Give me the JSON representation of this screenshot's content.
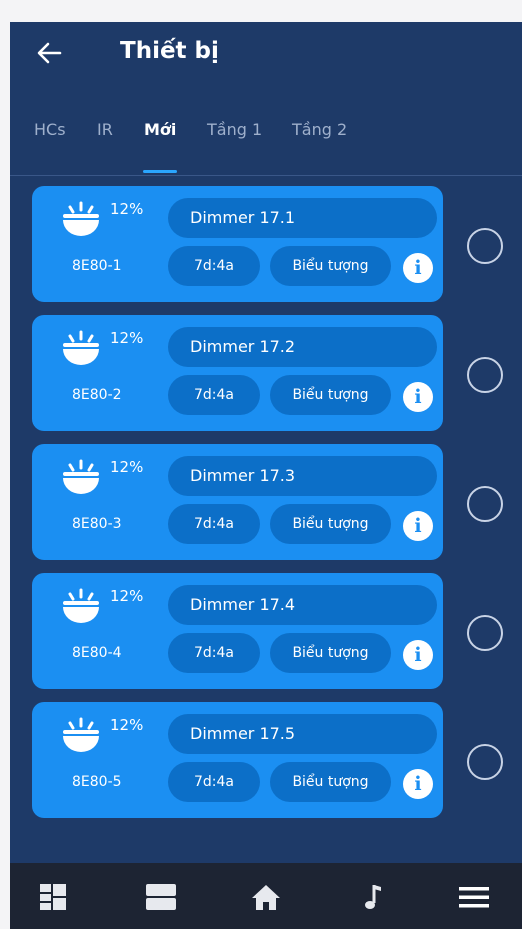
{
  "header": {
    "back_icon": "arrow-left-icon",
    "title": "Thiết bị"
  },
  "tabs": [
    {
      "label": "HCs",
      "active": false
    },
    {
      "label": "IR",
      "active": false
    },
    {
      "label": "Mới",
      "active": true
    },
    {
      "label": "Tầng 1",
      "active": false
    },
    {
      "label": "Tầng 2",
      "active": false
    }
  ],
  "devices": [
    {
      "level": "12%",
      "code": "8E80-1",
      "name": "Dimmer 17.1",
      "address": "7d:4a",
      "icon_label": "Biểu tượng",
      "selected": false
    },
    {
      "level": "12%",
      "code": "8E80-2",
      "name": "Dimmer 17.2",
      "address": "7d:4a",
      "icon_label": "Biểu tượng",
      "selected": false
    },
    {
      "level": "12%",
      "code": "8E80-3",
      "name": "Dimmer 17.3",
      "address": "7d:4a",
      "icon_label": "Biểu tượng",
      "selected": false
    },
    {
      "level": "12%",
      "code": "8E80-4",
      "name": "Dimmer 17.4",
      "address": "7d:4a",
      "icon_label": "Biểu tượng",
      "selected": false
    },
    {
      "level": "12%",
      "code": "8E80-5",
      "name": "Dimmer 17.5",
      "address": "7d:4a",
      "icon_label": "Biểu tượng",
      "selected": false
    }
  ],
  "bottom_nav": [
    {
      "icon": "dashboard-icon"
    },
    {
      "icon": "rooms-icon"
    },
    {
      "icon": "home-icon"
    },
    {
      "icon": "music-note-icon"
    },
    {
      "icon": "menu-icon"
    }
  ],
  "colors": {
    "background": "#1e3a68",
    "card": "#1b8ff2",
    "pill": "#0c6fc8",
    "tab_indicator": "#2aa6ff",
    "bottom_bar": "#1d2433"
  }
}
